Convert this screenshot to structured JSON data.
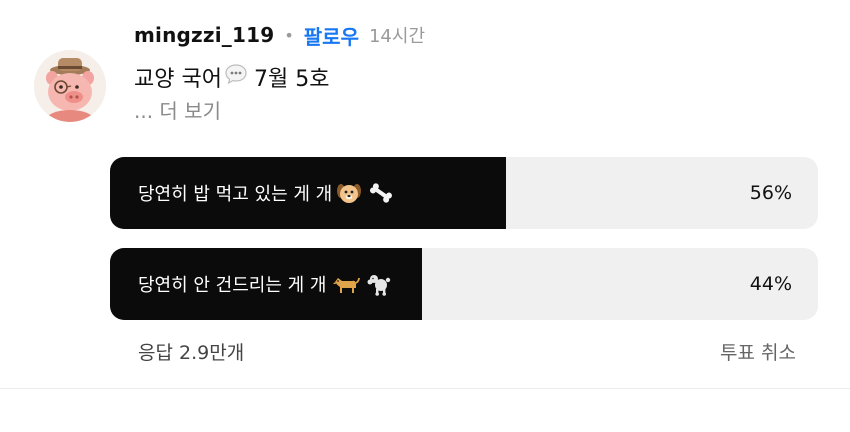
{
  "post": {
    "username": "mingzzi_119",
    "separator": "•",
    "follow_label": "팔로우",
    "time_ago": "14시간",
    "text_part1": "교양 국어",
    "text_part2": "7월 5호",
    "more_label": "... 더 보기"
  },
  "poll": {
    "options": [
      {
        "label": "당연히 밥 먹고 있는 게 개",
        "percent": 56,
        "percent_label": "56%",
        "icons": [
          "dog-face-icon",
          "bone-icon"
        ]
      },
      {
        "label": "당연히 안 건드리는 게 개",
        "percent": 44,
        "percent_label": "44%",
        "icons": [
          "dog-icon",
          "poodle-icon"
        ]
      }
    ],
    "responses_label": "응답 2.9만개",
    "cancel_label": "투표 취소"
  },
  "colors": {
    "follow": "#1877f2",
    "poll_fill": "#0b0b0b",
    "poll_track": "#f0f0f0"
  }
}
